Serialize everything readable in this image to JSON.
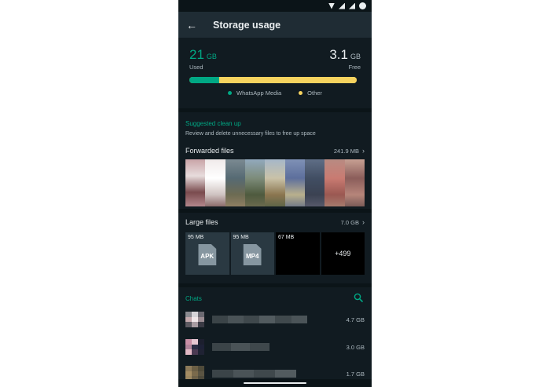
{
  "app_bar": {
    "title": "Storage usage",
    "back_icon": "arrow-left-icon"
  },
  "storage": {
    "used_value": "21",
    "used_unit": "GB",
    "used_label": "Used",
    "free_value": "3.1",
    "free_unit": "GB",
    "free_label": "Free",
    "whatsapp_media_fraction": 0.18,
    "legend": [
      {
        "label": "WhatsApp Media",
        "color": "#00a884"
      },
      {
        "label": "Other",
        "color": "#f6d35f"
      }
    ]
  },
  "suggested": {
    "title": "Suggested clean up",
    "description": "Review and delete unnecessary files to free up space",
    "forwarded": {
      "title": "Forwarded files",
      "size": "241.9 MB"
    },
    "large": {
      "title": "Large files",
      "size": "7.0 GB",
      "tiles": [
        {
          "size": "95 MB",
          "type": "APK"
        },
        {
          "size": "95 MB",
          "type": "MP4"
        },
        {
          "size": "67 MB"
        },
        {
          "more": "+499"
        }
      ]
    }
  },
  "chats": {
    "title": "Chats",
    "search_icon": "search-icon",
    "items": [
      {
        "size": "4.7 GB"
      },
      {
        "size": "3.0 GB"
      },
      {
        "size": "1.7 GB"
      }
    ]
  }
}
